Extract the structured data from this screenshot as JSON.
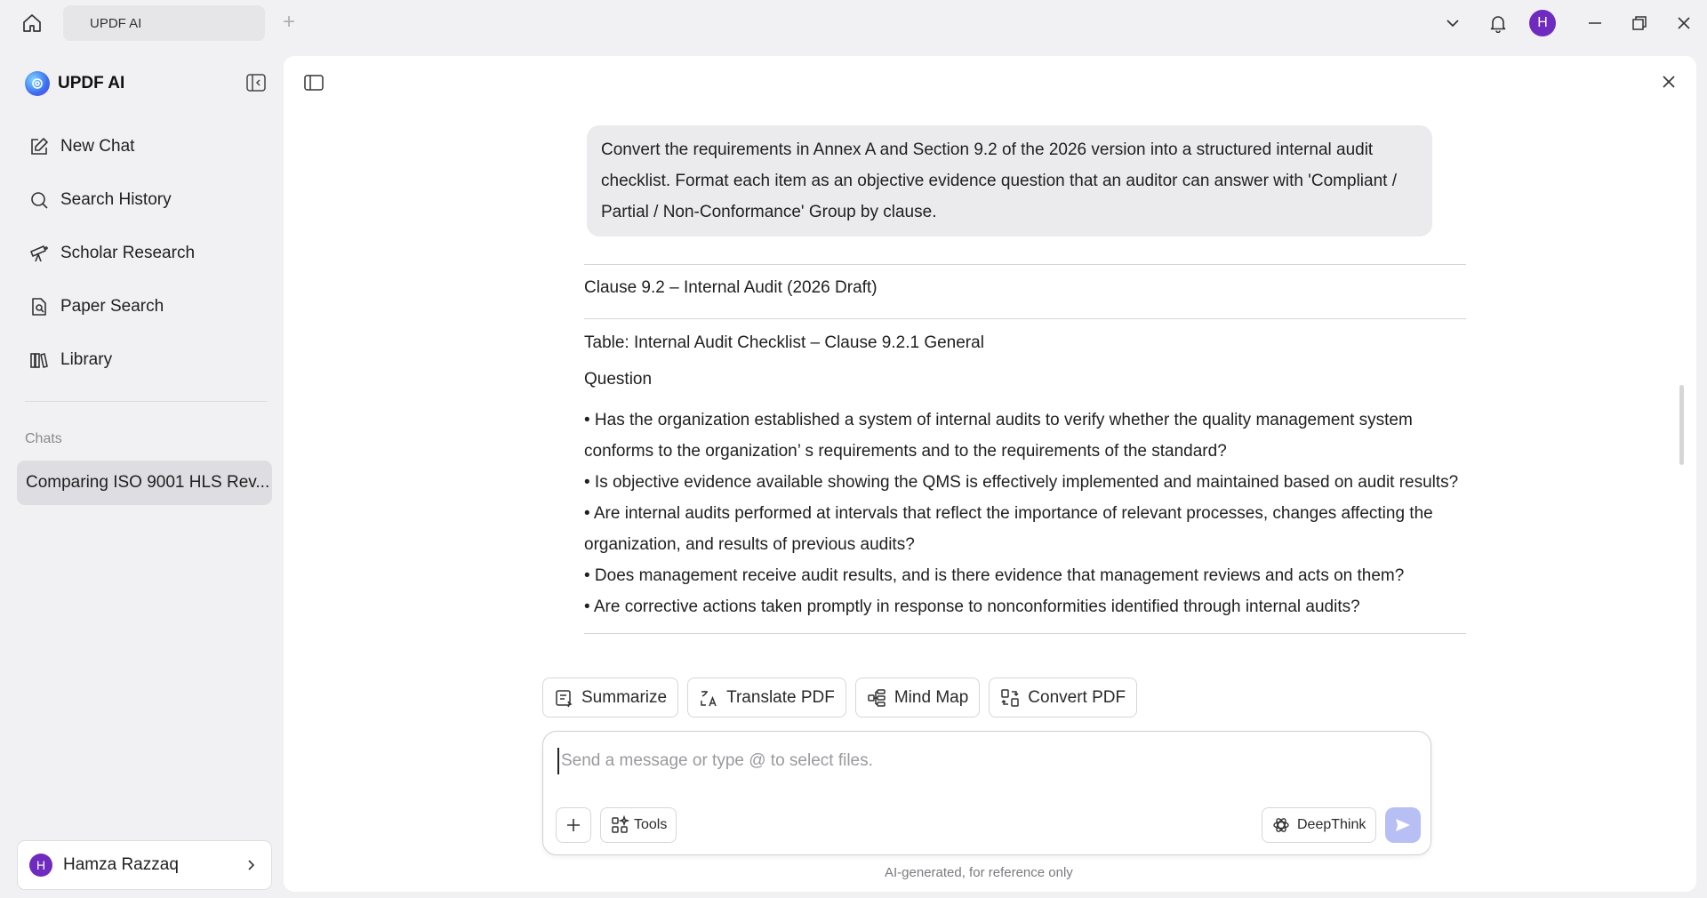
{
  "titlebar": {
    "tab_label": "UPDF AI",
    "add_tab": "+",
    "avatar_initial": "H"
  },
  "sidebar": {
    "brand": "UPDF AI",
    "items": [
      {
        "label": "New Chat",
        "icon": "edit-icon"
      },
      {
        "label": "Search History",
        "icon": "search-icon"
      },
      {
        "label": "Scholar Research",
        "icon": "telescope-icon"
      },
      {
        "label": "Paper Search",
        "icon": "document-search-icon"
      },
      {
        "label": "Library",
        "icon": "library-icon"
      }
    ],
    "chats_label": "Chats",
    "chat_active": "Comparing ISO 9001 HLS Rev...",
    "user": {
      "initial": "H",
      "name": "Hamza Razzaq"
    }
  },
  "conversation": {
    "user_message": "Convert the requirements in Annex A and Section 9.2 of the 2026 version into a structured internal audit checklist. Format each item as an objective evidence question that an auditor can answer with 'Compliant / Partial / Non-Conformance' Group by clause.",
    "clause_title": "Clause 9.2 – Internal Audit (2026 Draft)",
    "table_title": "Table: Internal Audit Checklist – Clause 9.2.1 General",
    "question_header": "Question",
    "questions": [
      "• Has the organization established a system of internal audits to verify whether the quality management system conforms to the organization’ s requirements and to the requirements of the standard?",
      "• Is objective evidence available showing the QMS is effectively implemented and maintained based on audit results?",
      "• Are internal audits performed at intervals that reflect the importance of relevant processes, changes affecting the organization, and results of previous audits?",
      "• Does management receive audit results, and is there evidence that management reviews and acts on them?",
      "• Are corrective actions taken promptly in response to nonconformities identified through internal audits?"
    ]
  },
  "actions": {
    "summarize": "Summarize",
    "translate": "Translate PDF",
    "mindmap": "Mind Map",
    "convert": "Convert PDF"
  },
  "composer": {
    "placeholder": "Send a message or type @ to select files.",
    "tools": "Tools",
    "deepthink": "DeepThink",
    "disclaimer": "AI-generated, for reference only"
  },
  "colors": {
    "accent": "#6f2bbf",
    "send_disabled": "#b7bff5",
    "sidebar_bg": "#f1f1f3"
  }
}
